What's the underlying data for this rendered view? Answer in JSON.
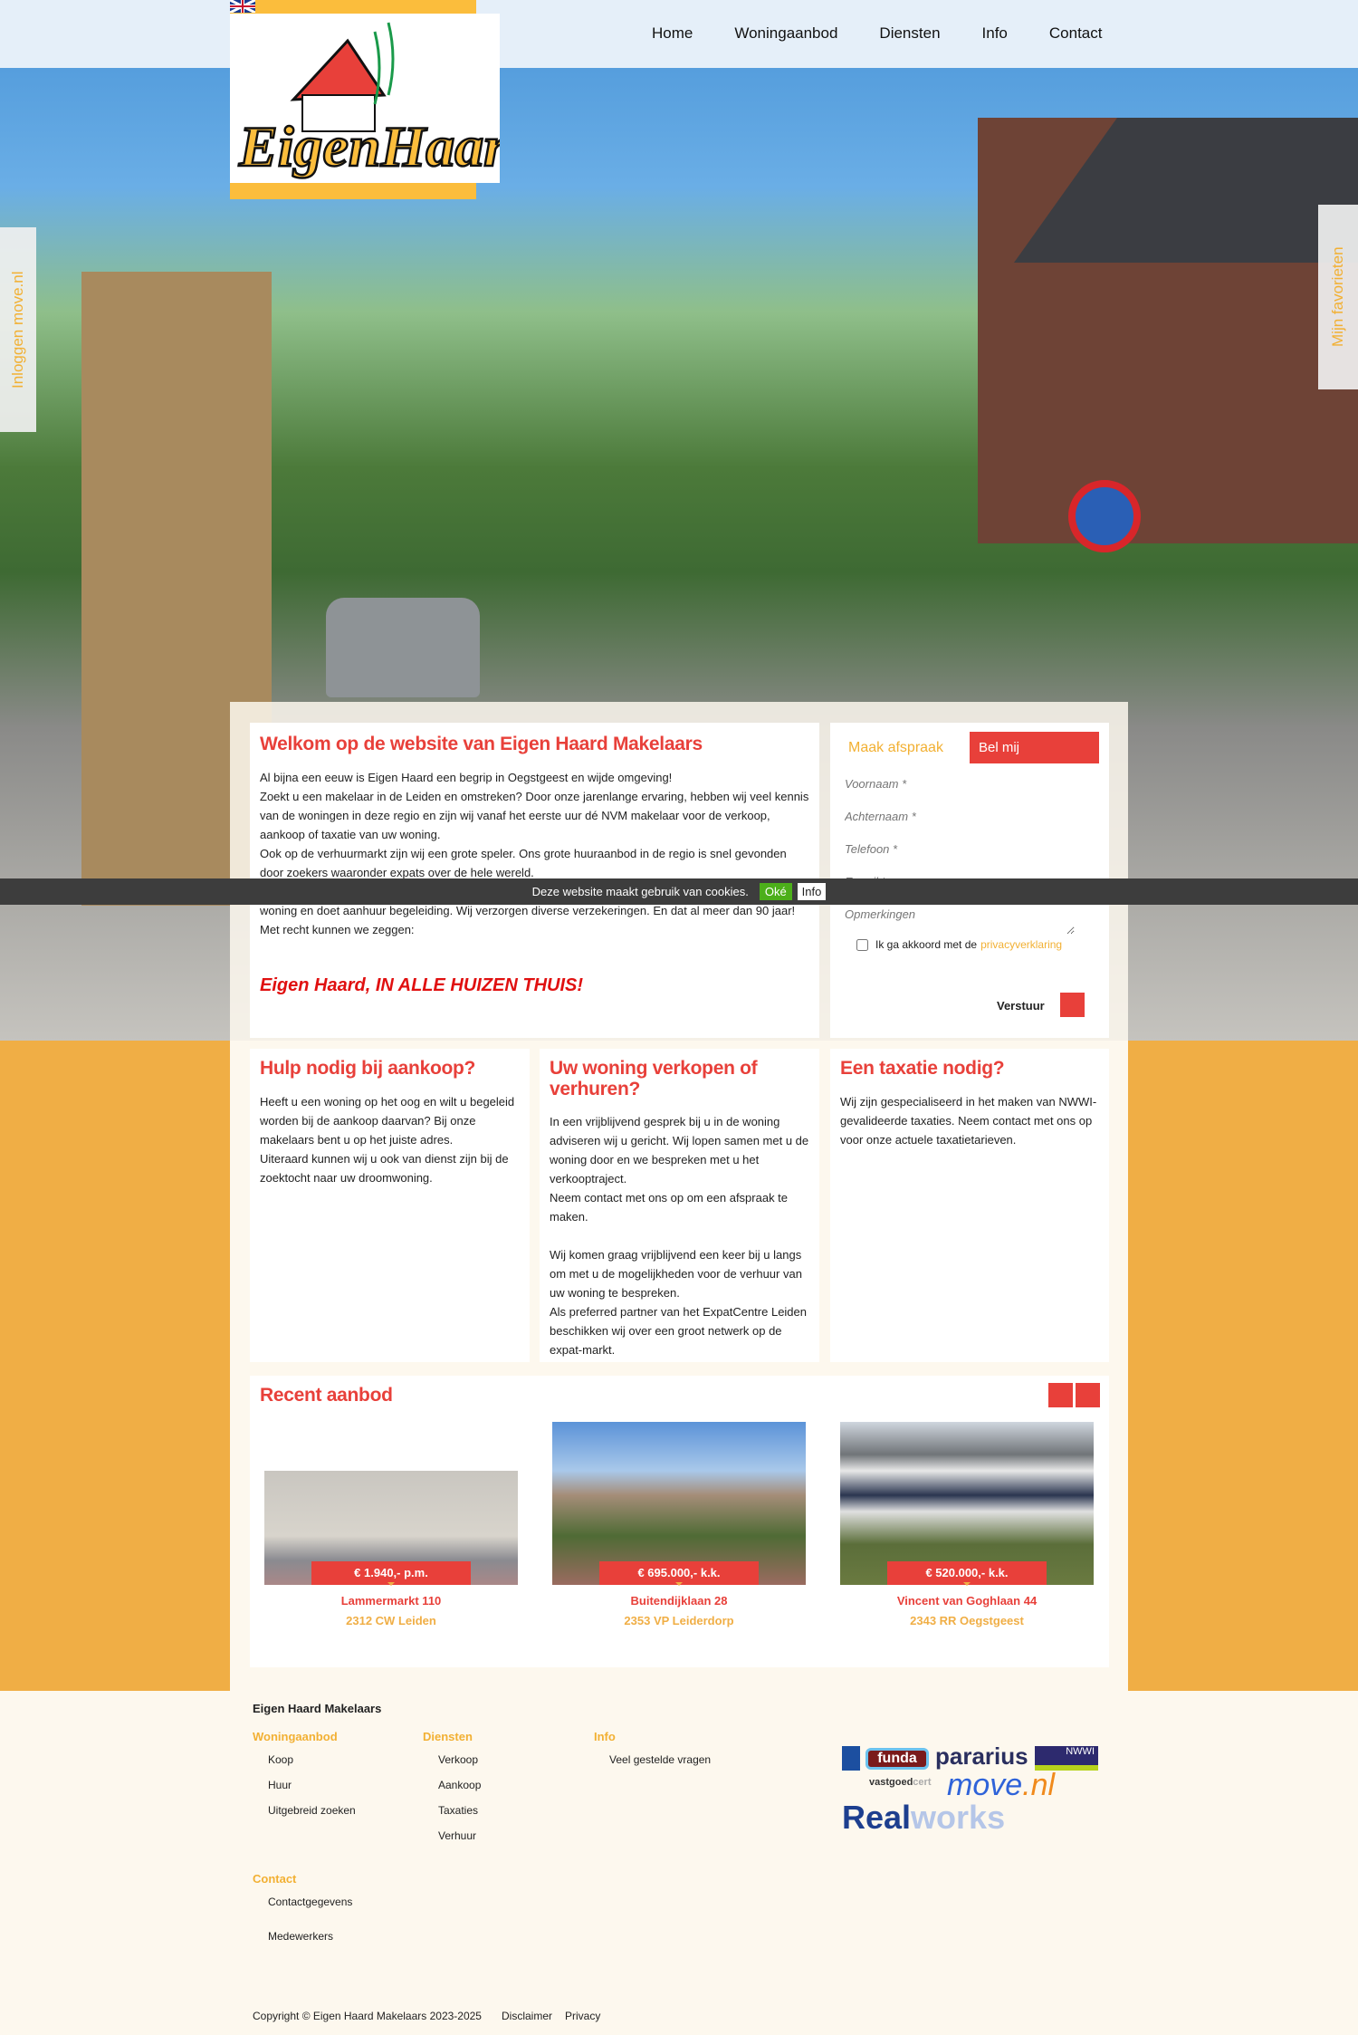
{
  "header": {
    "nav": [
      "Home",
      "Woningaanbod",
      "Diensten",
      "Info",
      "Contact"
    ],
    "logo_text": "Eigen Haard",
    "language_flag": "uk-flag-icon"
  },
  "side_tabs": {
    "left": "Inloggen move.nl",
    "right": "Mijn favorieten"
  },
  "welcome": {
    "title": "Welkom op de website van Eigen Haard Makelaars",
    "paragraphs": [
      "Al bijna een eeuw is Eigen Haard een begrip in Oegstgeest en wijde omgeving!",
      "Zoekt u een makelaar in de Leiden en omstreken? Door onze jarenlange ervaring, hebben wij veel kennis van de woningen in deze regio en zijn wij vanaf het eerste uur  dé NVM makelaar voor de verkoop, aankoop of taxatie van uw woning.",
      "Ook op de verhuurmarkt zijn wij een grote speler. Ons grote huuraanbod in de regio is snel gevonden door zoekers waaronder expats over de hele wereld.",
      "woning en doet aanhuur begeleiding. Wij verzorgen diverse verzekeringen. En dat al meer dan 90 jaar!",
      "Met recht kunnen we zeggen:"
    ],
    "slogan": "Eigen Haard, IN ALLE HUIZEN THUIS!"
  },
  "form": {
    "tab_active": "Maak afspraak",
    "tab_other": "Bel mij",
    "fields": [
      "Voornaam *",
      "Achternaam *",
      "Telefoon *",
      "E-mail *",
      "Opmerkingen"
    ],
    "consent_prefix": "Ik ga akkoord met de",
    "consent_link": "privacyverklaring",
    "submit": "Verstuur"
  },
  "cookie": {
    "text": "Deze website maakt gebruik van cookies.",
    "ok": "Oké",
    "info": "Info"
  },
  "columns": [
    {
      "title": "Hulp nodig bij aankoop?",
      "paragraphs": [
        "Heeft u een woning op het oog en wilt u begeleid worden bij de aankoop daarvan? Bij onze makelaars bent u op het juiste adres.",
        "Uiteraard kunnen wij u ook van dienst zijn bij de zoektocht naar uw droomwoning."
      ]
    },
    {
      "title": "Uw woning verkopen of verhuren?",
      "paragraphs": [
        "In een vrijblijvend gesprek bij u in de woning adviseren wij u gericht. Wij lopen samen met u de woning door en we bespreken met u het verkooptraject.",
        "Neem contact met ons op om een afspraak te maken.",
        "",
        "Wij komen graag vrijblijvend een keer bij u langs om met u de mogelijkheden voor de verhuur van uw woning te bespreken.",
        "Als preferred partner van het ExpatCentre Leiden beschikken wij over een groot netwerk op de expat-markt."
      ]
    },
    {
      "title": "Een taxatie nodig?",
      "paragraphs": [
        "Wij zijn gespecialiseerd in het maken van NWWI-gevalideerde taxaties. Neem contact met ons op voor onze actuele taxatietarieven."
      ]
    }
  ],
  "recent": {
    "title": "Recent aanbod",
    "items": [
      {
        "price": "€ 1.940,- p.m.",
        "address": "Lammermarkt 110",
        "city": "2312 CW Leiden"
      },
      {
        "price": "€ 695.000,- k.k.",
        "address": "Buitendijklaan 28",
        "city": "2353 VP Leiderdorp"
      },
      {
        "price": "€ 520.000,- k.k.",
        "address": "Vincent van Goghlaan 44",
        "city": "2343 RR Oegstgeest"
      }
    ]
  },
  "footer": {
    "company": "Eigen Haard Makelaars",
    "groups": [
      {
        "title": "Woningaanbod",
        "links": [
          "Koop",
          "Huur",
          "Uitgebreid zoeken"
        ]
      },
      {
        "title": "Diensten",
        "links": [
          "Verkoop",
          "Aankoop",
          "Taxaties",
          "Verhuur"
        ]
      },
      {
        "title": "Info",
        "links": [
          "Veel gestelde vragen"
        ]
      }
    ],
    "contact": {
      "title": "Contact",
      "links": [
        "Contactgegevens",
        "Medewerkers"
      ]
    },
    "logos": [
      "NVM",
      "funda",
      "pararius",
      "NWWI",
      "vastgoedcert gecertificeerd",
      "move.nl",
      "Realworks"
    ],
    "copyright": "Copyright © Eigen Haard Makelaars 2023-2025",
    "disclaimer": "Disclaimer",
    "privacy": "Privacy"
  },
  "colors": {
    "accent_red": "#e8403a",
    "accent_orange": "#f0ae45",
    "footer_bg": "#fdf8ee"
  }
}
